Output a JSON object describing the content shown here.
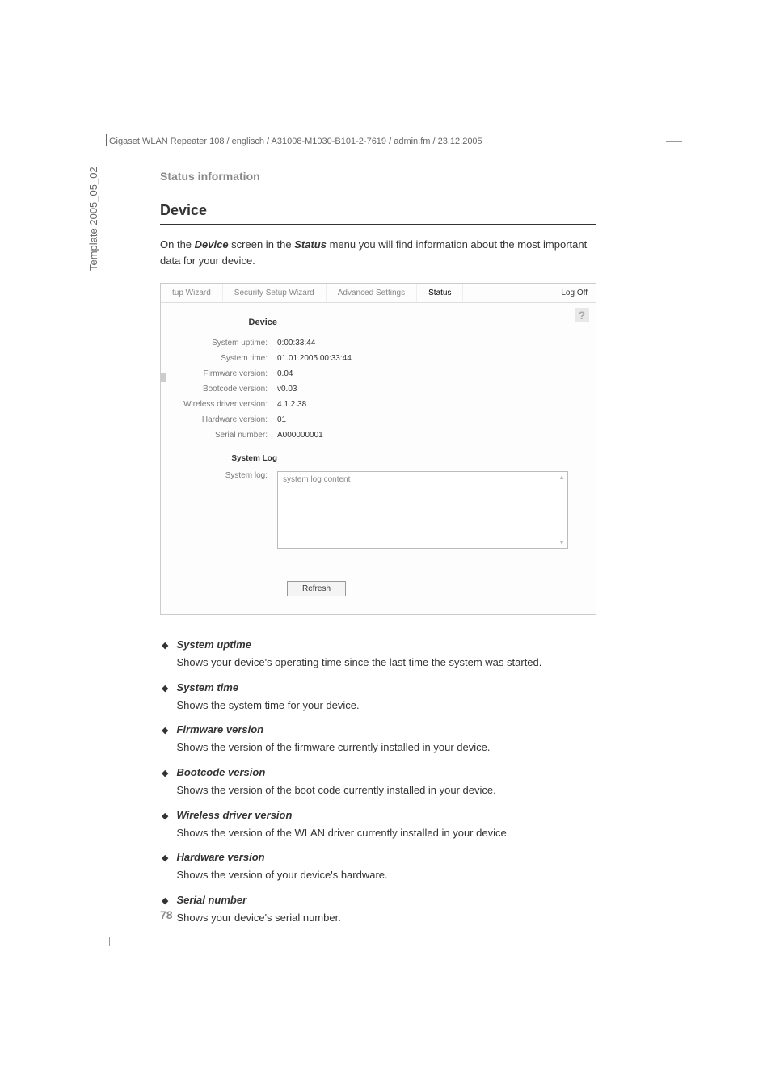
{
  "header": {
    "path": "Gigaset WLAN Repeater 108 / englisch / A31008-M1030-B101-2-7619 / admin.fm / 23.12.2005"
  },
  "sidebar": {
    "template": "Template 2005_05_02"
  },
  "page": {
    "number": "78",
    "section_label": "Status information",
    "title": "Device",
    "intro_pre": "On the ",
    "intro_bold1": "Device",
    "intro_mid": " screen in the ",
    "intro_bold2": "Status",
    "intro_post": " menu you will find information about the most important data for your device."
  },
  "screenshot": {
    "tabs": {
      "setup": "tup Wizard",
      "security": "Security Setup Wizard",
      "advanced": "Advanced Settings",
      "status": "Status"
    },
    "logoff": "Log Off",
    "help": "?",
    "heading": "Device",
    "rows": {
      "uptime_label": "System uptime:",
      "uptime_value": "0:00:33:44",
      "systime_label": "System time:",
      "systime_value": "01.01.2005 00:33:44",
      "firmware_label": "Firmware version:",
      "firmware_value": "0.04",
      "bootcode_label": "Bootcode version:",
      "bootcode_value": "v0.03",
      "wireless_label": "Wireless driver version:",
      "wireless_value": "4.1.2.38",
      "hardware_label": "Hardware version:",
      "hardware_value": "01",
      "serial_label": "Serial number:",
      "serial_value": "A000000001"
    },
    "syslog_heading": "System Log",
    "syslog_label": "System log:",
    "syslog_content": "system log content",
    "refresh": "Refresh"
  },
  "bullets": [
    {
      "title": "System uptime",
      "desc": "Shows your device's operating time since the last time the system was started."
    },
    {
      "title": "System time",
      "desc": "Shows the system time for your device."
    },
    {
      "title": "Firmware version",
      "desc": "Shows the version of the firmware currently installed in your device."
    },
    {
      "title": "Bootcode version",
      "desc": "Shows the version of the boot code currently installed in your device."
    },
    {
      "title": "Wireless driver version",
      "desc": "Shows the version of the WLAN driver currently installed in your device."
    },
    {
      "title": "Hardware version",
      "desc": "Shows the version of your device's hardware."
    },
    {
      "title": "Serial number",
      "desc": "Shows your device's serial number."
    }
  ]
}
